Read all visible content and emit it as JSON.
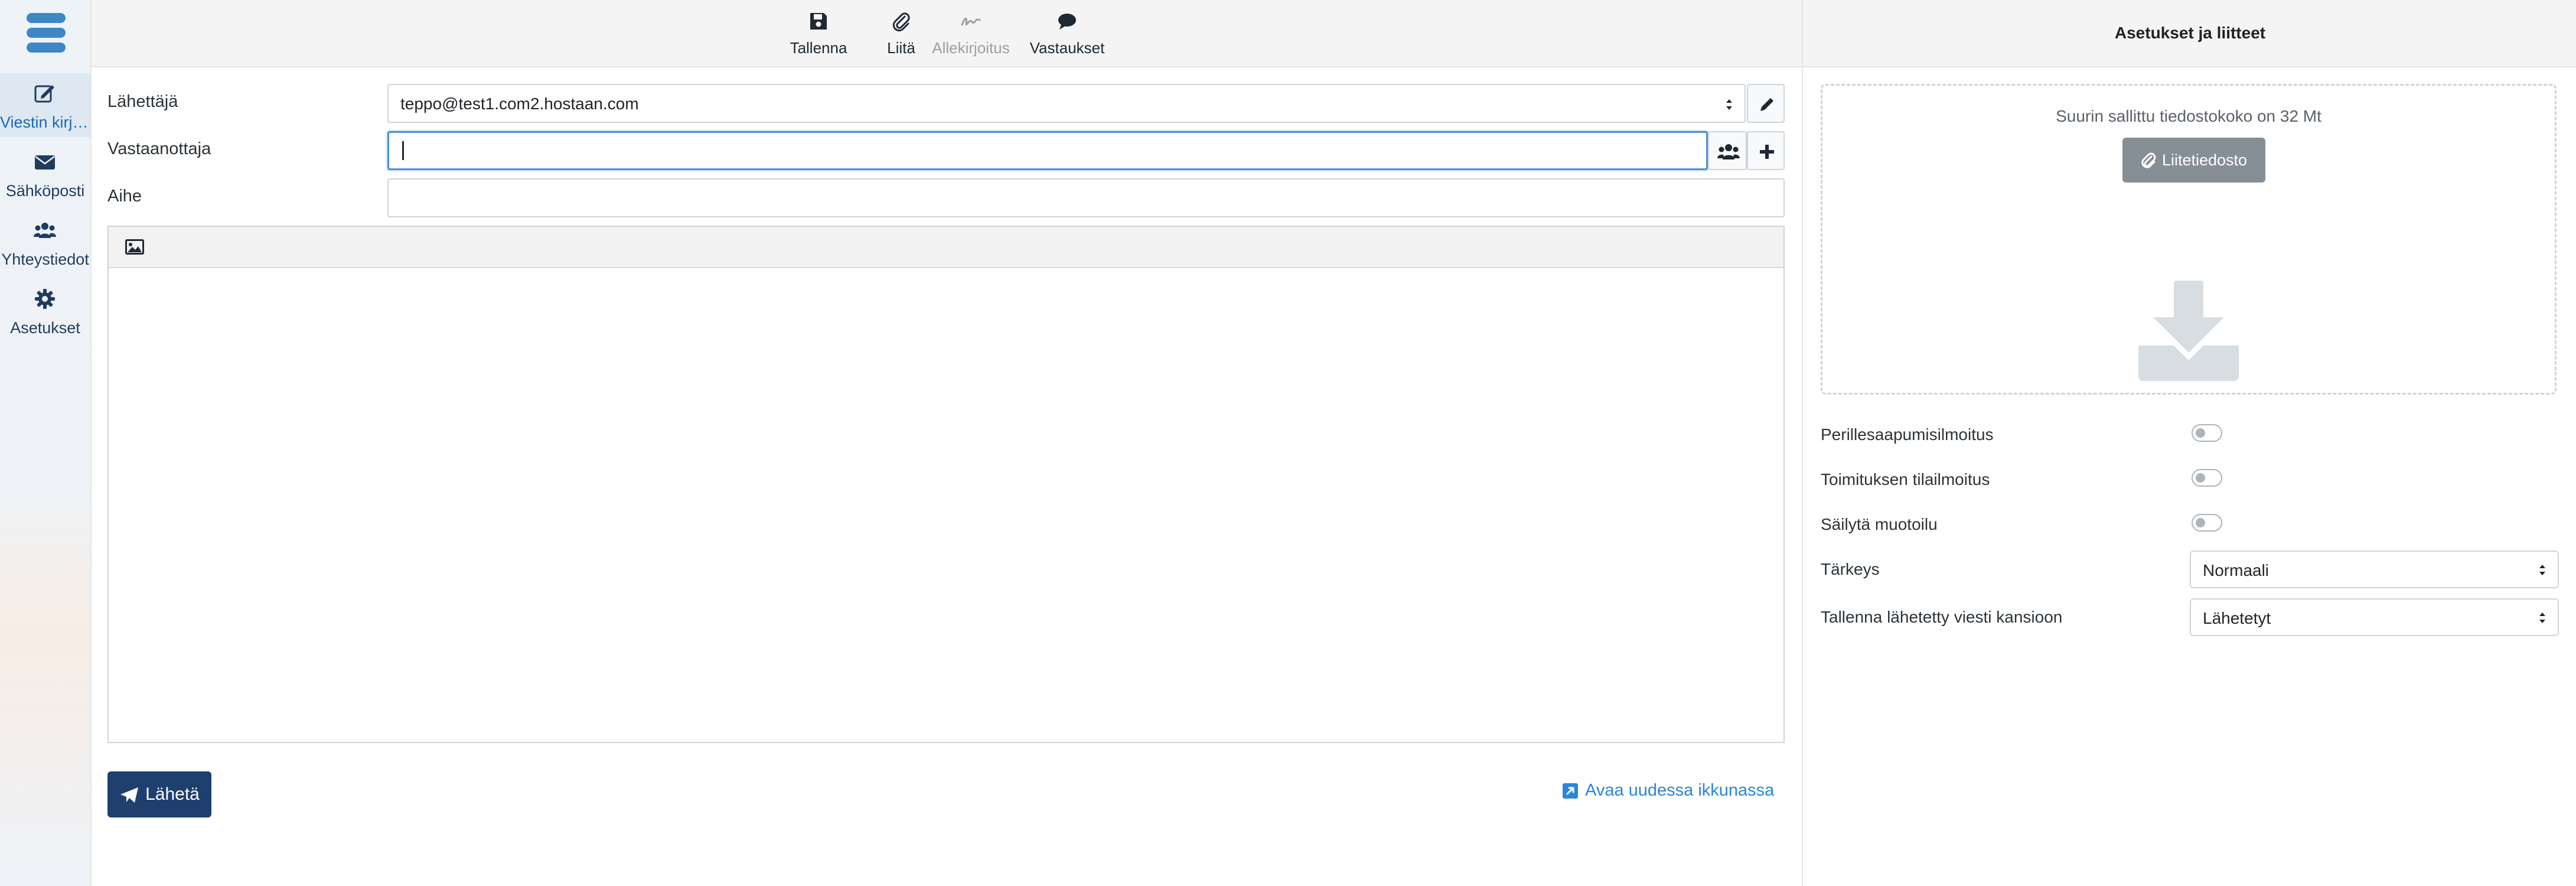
{
  "sidebar": {
    "items": [
      {
        "label": "Viestin kirjo…",
        "icon": "compose-icon",
        "active": true
      },
      {
        "label": "Sähköposti",
        "icon": "envelope-icon",
        "active": false
      },
      {
        "label": "Yhteystiedot",
        "icon": "users-icon",
        "active": false
      },
      {
        "label": "Asetukset",
        "icon": "gear-icon",
        "active": false
      }
    ]
  },
  "toolbar": {
    "save_label": "Tallenna",
    "attach_label": "Liitä",
    "signature_label": "Allekirjoitus",
    "responses_label": "Vastaukset"
  },
  "compose": {
    "from_label": "Lähettäjä",
    "from_value": "teppo@test1.com2.hostaan.com",
    "to_label": "Vastaanottaja",
    "to_value": "",
    "subject_label": "Aihe",
    "subject_value": "",
    "body": ""
  },
  "actions": {
    "send_label": "Lähetä",
    "open_new_window_label": "Avaa uudessa ikkunassa"
  },
  "panel": {
    "title": "Asetukset ja liitteet",
    "max_size_text": "Suurin sallittu tiedostokoko on 32 Mt",
    "attach_button": "Liitetiedosto",
    "options": [
      {
        "label": "Perillesaapumisilmoitus",
        "enabled": false
      },
      {
        "label": "Toimituksen tilailmoitus",
        "enabled": false
      },
      {
        "label": "Säilytä muotoilu",
        "enabled": false
      }
    ],
    "priority_label": "Tärkeys",
    "priority_value": "Normaali",
    "save_folder_label": "Tallenna lähetetty viesti kansioon",
    "save_folder_value": "Lähetetyt"
  },
  "colors": {
    "accent": "#3f86c6",
    "send_button": "#1f3f6e",
    "link": "#2b86d8",
    "attach_button": "#868e96"
  }
}
